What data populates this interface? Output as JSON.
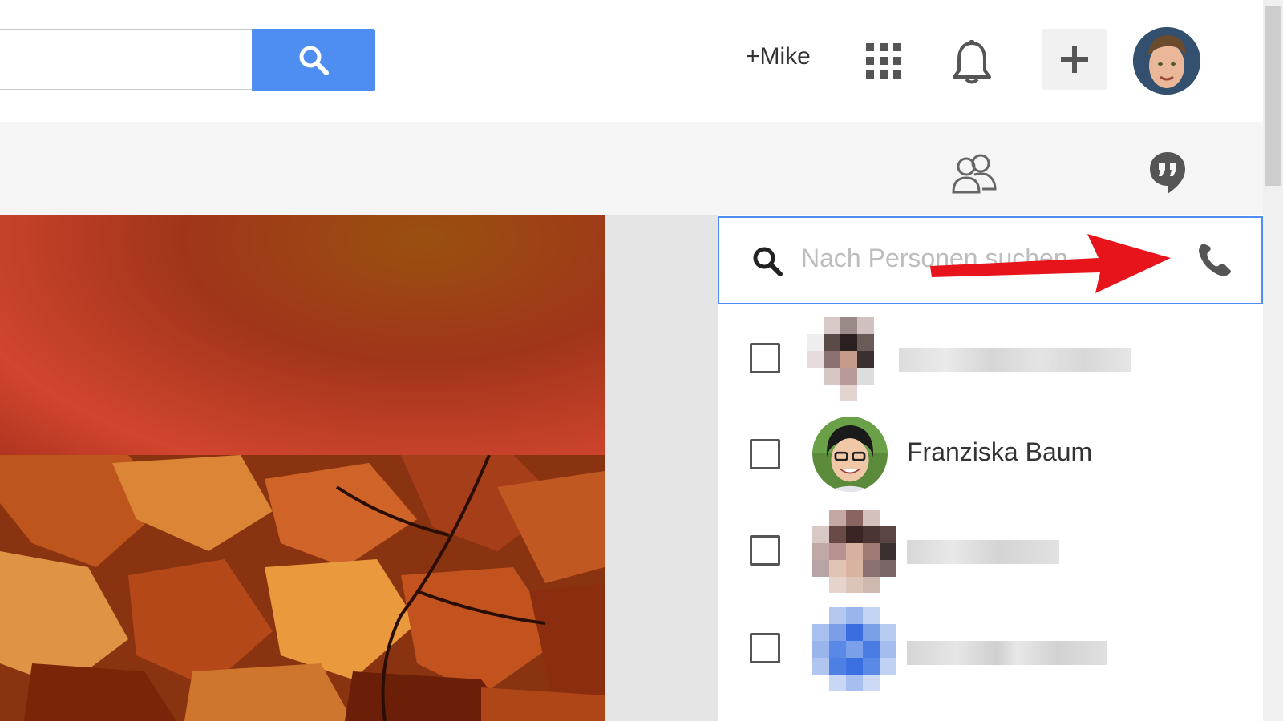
{
  "header": {
    "search_value": "",
    "profile_link": "+Mike",
    "icons": [
      "search-icon",
      "apps-grid-icon",
      "bell-icon",
      "plus-icon"
    ],
    "accent_color": "#4d8ef0"
  },
  "subbar": {
    "icons": [
      "people-icon",
      "hangouts-icon"
    ]
  },
  "people": {
    "search_placeholder": "Nach Personen suchen",
    "call_icon": "phone-icon",
    "contacts": [
      {
        "name": "",
        "blurred": true
      },
      {
        "name": "Franziska Baum",
        "blurred": false
      },
      {
        "name": "",
        "blurred": true
      },
      {
        "name": "",
        "blurred": true
      }
    ]
  },
  "annotation": {
    "arrow_color": "#e8141c"
  }
}
